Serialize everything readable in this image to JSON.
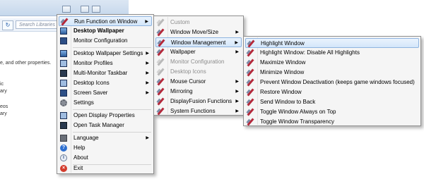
{
  "background": {
    "search_placeholder": "Search Libraries",
    "refresh_glyph": "↻",
    "sidebar_lines": [
      "e, and other properties.",
      "ic",
      "ary",
      "eos",
      "ary"
    ]
  },
  "main_menu": {
    "items": [
      {
        "label": "Run Function on Window",
        "icon": "pen-icon",
        "submenu": true
      },
      {
        "label": "Desktop Wallpaper",
        "icon": "wallpaper-icon"
      },
      {
        "label": "Monitor Configuration",
        "icon": "monitor-icon"
      },
      {
        "label": "Desktop Wallpaper Settings",
        "icon": "wallpaper-settings-icon",
        "submenu": true
      },
      {
        "label": "Monitor Profiles",
        "icon": "monitor-profiles-icon",
        "submenu": true
      },
      {
        "label": "Multi-Monitor Taskbar",
        "icon": "taskbar-icon",
        "submenu": true
      },
      {
        "label": "Desktop Icons",
        "icon": "desktop-icons-icon",
        "submenu": true
      },
      {
        "label": "Screen Saver",
        "icon": "screen-saver-icon",
        "submenu": true
      },
      {
        "label": "Settings",
        "icon": "gear-icon"
      },
      {
        "label": "Open Display Properties",
        "icon": "display-icon"
      },
      {
        "label": "Open Task Manager",
        "icon": "task-manager-icon"
      },
      {
        "label": "Language",
        "icon": "language-icon",
        "submenu": true
      },
      {
        "label": "Help",
        "icon": "help-icon"
      },
      {
        "label": "About",
        "icon": "info-icon"
      },
      {
        "label": "Exit",
        "icon": "exit-icon"
      }
    ]
  },
  "function_menu": {
    "items": [
      {
        "label": "Custom",
        "disabled": true
      },
      {
        "label": "Window Move/Size",
        "submenu": true
      },
      {
        "label": "Window Management",
        "submenu": true
      },
      {
        "label": "Wallpaper",
        "submenu": true
      },
      {
        "label": "Monitor Configuration",
        "disabled": true
      },
      {
        "label": "Desktop Icons",
        "disabled": true
      },
      {
        "label": "Mouse Cursor",
        "submenu": true
      },
      {
        "label": "Mirroring",
        "submenu": true
      },
      {
        "label": "DisplayFusion Functions",
        "submenu": true
      },
      {
        "label": "System Functions",
        "submenu": true
      }
    ]
  },
  "window_mgmt_menu": {
    "items": [
      {
        "label": "Highlight Window"
      },
      {
        "label": "Highlight Window: Disable All Highlights"
      },
      {
        "label": "Maximize Window"
      },
      {
        "label": "Minimize Window"
      },
      {
        "label": "Prevent Window Deactivation (keeps game windows focused)"
      },
      {
        "label": "Restore Window"
      },
      {
        "label": "Send Window to Back"
      },
      {
        "label": "Toggle Window Always on Top"
      },
      {
        "label": "Toggle Window Transparency"
      }
    ]
  },
  "arrow_glyph": "▶"
}
